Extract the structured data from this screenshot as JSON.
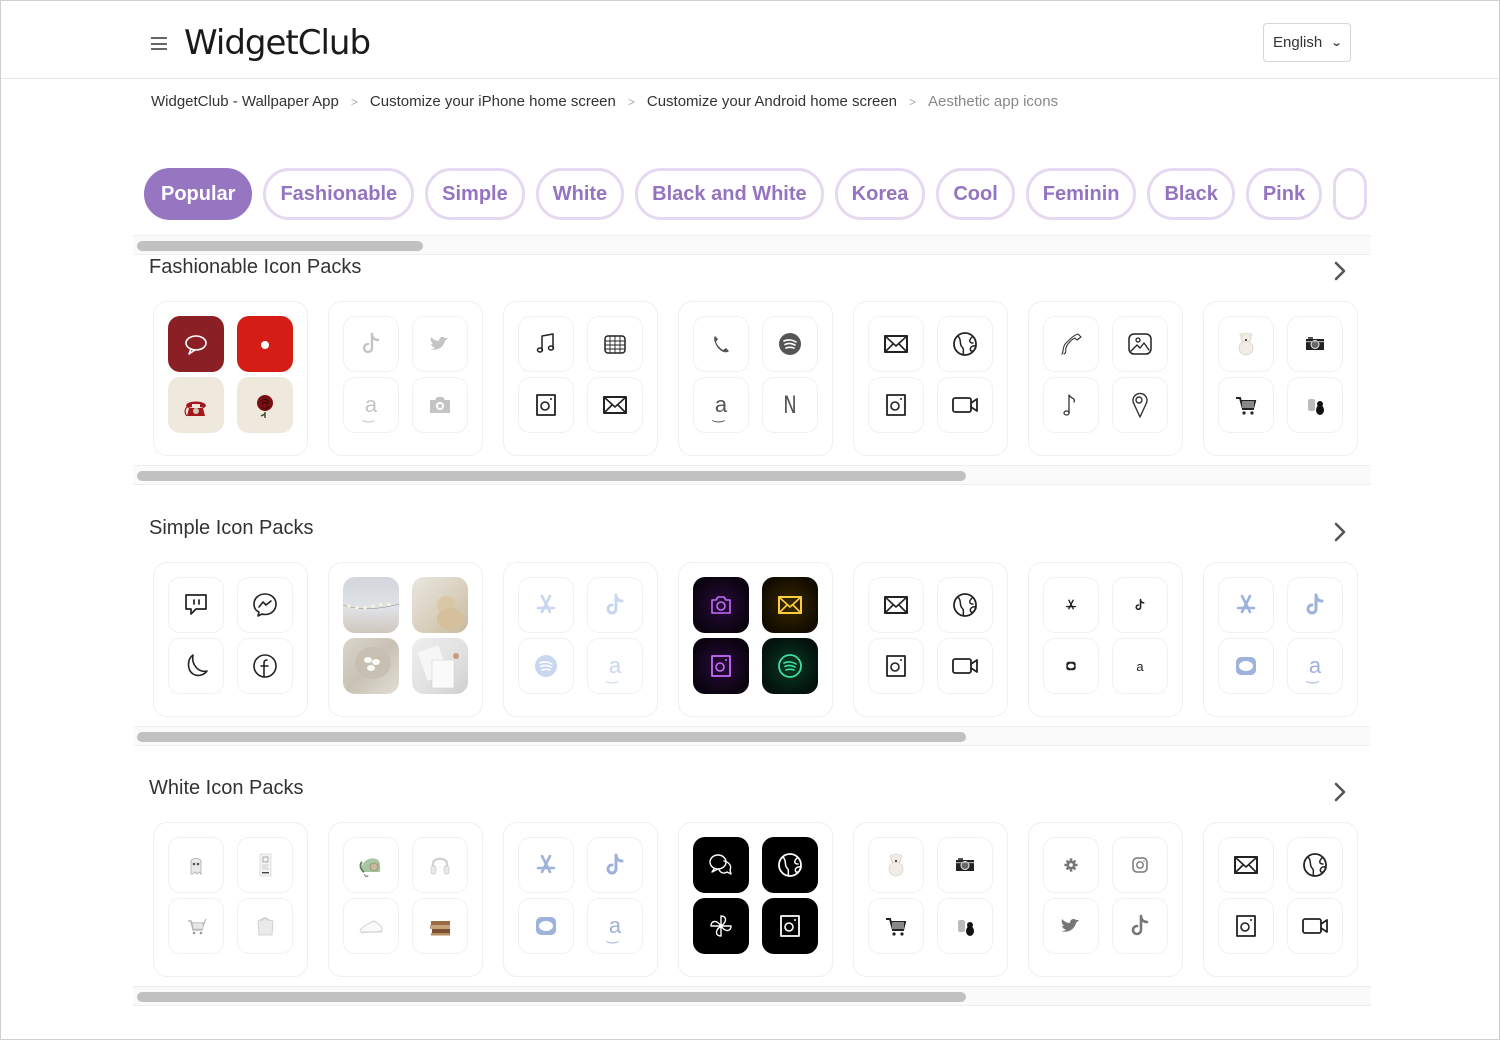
{
  "header": {
    "logo": "WidgetClub",
    "language_selected": "English"
  },
  "breadcrumb": [
    {
      "label": "WidgetClub - Wallpaper App"
    },
    {
      "label": "Customize your iPhone home screen"
    },
    {
      "label": "Customize your Android home screen"
    },
    {
      "label": "Aesthetic app icons"
    }
  ],
  "breadcrumb_separator": ">",
  "categories": [
    {
      "label": "Popular",
      "active": true
    },
    {
      "label": "Fashionable"
    },
    {
      "label": "Simple"
    },
    {
      "label": "White"
    },
    {
      "label": "Black and White"
    },
    {
      "label": "Korea"
    },
    {
      "label": "Cool"
    },
    {
      "label": "Feminin"
    },
    {
      "label": "Black"
    },
    {
      "label": "Pink"
    },
    {
      "label": ""
    }
  ],
  "colors": {
    "accent": "#9676c1",
    "chip_border": "#e4d9f1",
    "chip_text": "#9474c1"
  },
  "sections": [
    {
      "title": "Fashionable Icon Packs",
      "scroll_fraction": 0.67,
      "packs": [
        {
          "name": "red-retro",
          "icons": [
            "speech-bubble-icon",
            "camera-icon",
            "rotary-phone-icon",
            "rose-icon"
          ]
        },
        {
          "name": "light-gray",
          "icons": [
            "tiktok-icon",
            "twitter-icon",
            "amazon-icon",
            "camera-icon"
          ]
        },
        {
          "name": "sketch-black",
          "icons": [
            "music-note-icon",
            "calendar-icon",
            "instagram-icon",
            "mail-icon"
          ]
        },
        {
          "name": "gray-solid",
          "icons": [
            "phone-icon",
            "spotify-icon",
            "amazon-icon",
            "netflix-icon"
          ]
        },
        {
          "name": "line-black",
          "icons": [
            "mail-icon",
            "globe-icon",
            "instagram-icon",
            "video-icon"
          ]
        },
        {
          "name": "hand-drawn",
          "icons": [
            "phone-icon",
            "photo-icon",
            "music-note-icon",
            "map-pin-icon"
          ]
        },
        {
          "name": "monochrome-objects",
          "icons": [
            "teddy-bear-icon",
            "camera-icon",
            "shopping-cart-icon",
            "bears-icon"
          ]
        }
      ]
    },
    {
      "title": "Simple Icon Packs",
      "scroll_fraction": 0.67,
      "packs": [
        {
          "name": "outline-black",
          "icons": [
            "twitch-icon",
            "messenger-icon",
            "moon-icon",
            "facebook-icon"
          ]
        },
        {
          "name": "photo-aesthetic",
          "icons": [
            "lights-photo-icon",
            "teddy-bear-photo-icon",
            "macarons-photo-icon",
            "papers-photo-icon"
          ]
        },
        {
          "name": "pale-blue",
          "icons": [
            "app-store-icon",
            "tiktok-icon",
            "spotify-icon",
            "amazon-icon"
          ]
        },
        {
          "name": "neon",
          "icons": [
            "camera-icon",
            "mail-icon",
            "instagram-icon",
            "spotify-icon"
          ]
        },
        {
          "name": "line-black",
          "icons": [
            "mail-icon",
            "globe-icon",
            "instagram-icon",
            "video-icon"
          ]
        },
        {
          "name": "tiny-black",
          "icons": [
            "app-store-icon",
            "tiktok-icon",
            "line-icon",
            "amazon-icon"
          ]
        },
        {
          "name": "periwinkle",
          "icons": [
            "app-store-icon",
            "tiktok-icon",
            "line-icon",
            "amazon-icon"
          ]
        }
      ]
    },
    {
      "title": "White Icon Packs",
      "scroll_fraction": 0.67,
      "packs": [
        {
          "name": "white-objects",
          "icons": [
            "ghost-icon",
            "receipt-icon",
            "shopping-cart-icon",
            "bag-icon"
          ]
        },
        {
          "name": "vintage-objects",
          "icons": [
            "rotary-phone-icon",
            "headphones-icon",
            "sneaker-icon",
            "books-icon"
          ]
        },
        {
          "name": "periwinkle",
          "icons": [
            "app-store-icon",
            "tiktok-icon",
            "line-icon",
            "amazon-icon"
          ]
        },
        {
          "name": "black-tile",
          "icons": [
            "chat-icon",
            "globe-icon",
            "pinwheel-icon",
            "instagram-icon"
          ]
        },
        {
          "name": "monochrome-objects",
          "icons": [
            "teddy-bear-icon",
            "camera-icon",
            "shopping-cart-icon",
            "bears-icon"
          ]
        },
        {
          "name": "gray-solid",
          "icons": [
            "settings-icon",
            "instagram-icon",
            "twitter-icon",
            "tiktok-icon"
          ]
        },
        {
          "name": "line-black",
          "icons": [
            "mail-icon",
            "globe-icon",
            "instagram-icon",
            "video-icon"
          ]
        }
      ]
    }
  ]
}
